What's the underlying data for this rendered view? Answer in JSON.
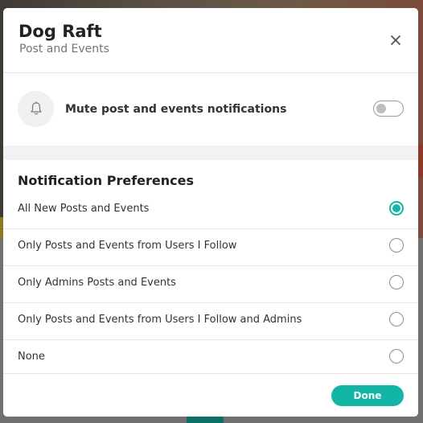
{
  "modal": {
    "title": "Dog Raft",
    "subtitle": "Post and Events",
    "close_icon": "close-icon"
  },
  "mute": {
    "icon": "bell-icon",
    "label": "Mute post and events notifications",
    "enabled": false
  },
  "preferences": {
    "heading": "Notification Preferences",
    "options": [
      {
        "label": "All New Posts and Events",
        "selected": true
      },
      {
        "label": "Only Posts and Events from Users I Follow",
        "selected": false
      },
      {
        "label": "Only Admins Posts and Events",
        "selected": false
      },
      {
        "label": "Only Posts and Events from Users I Follow and Admins",
        "selected": false
      },
      {
        "label": "None",
        "selected": false
      }
    ]
  },
  "footer": {
    "done_label": "Done"
  },
  "colors": {
    "accent": "#12b5a6",
    "title": "#222222",
    "overlay": "#6b6b6b"
  }
}
